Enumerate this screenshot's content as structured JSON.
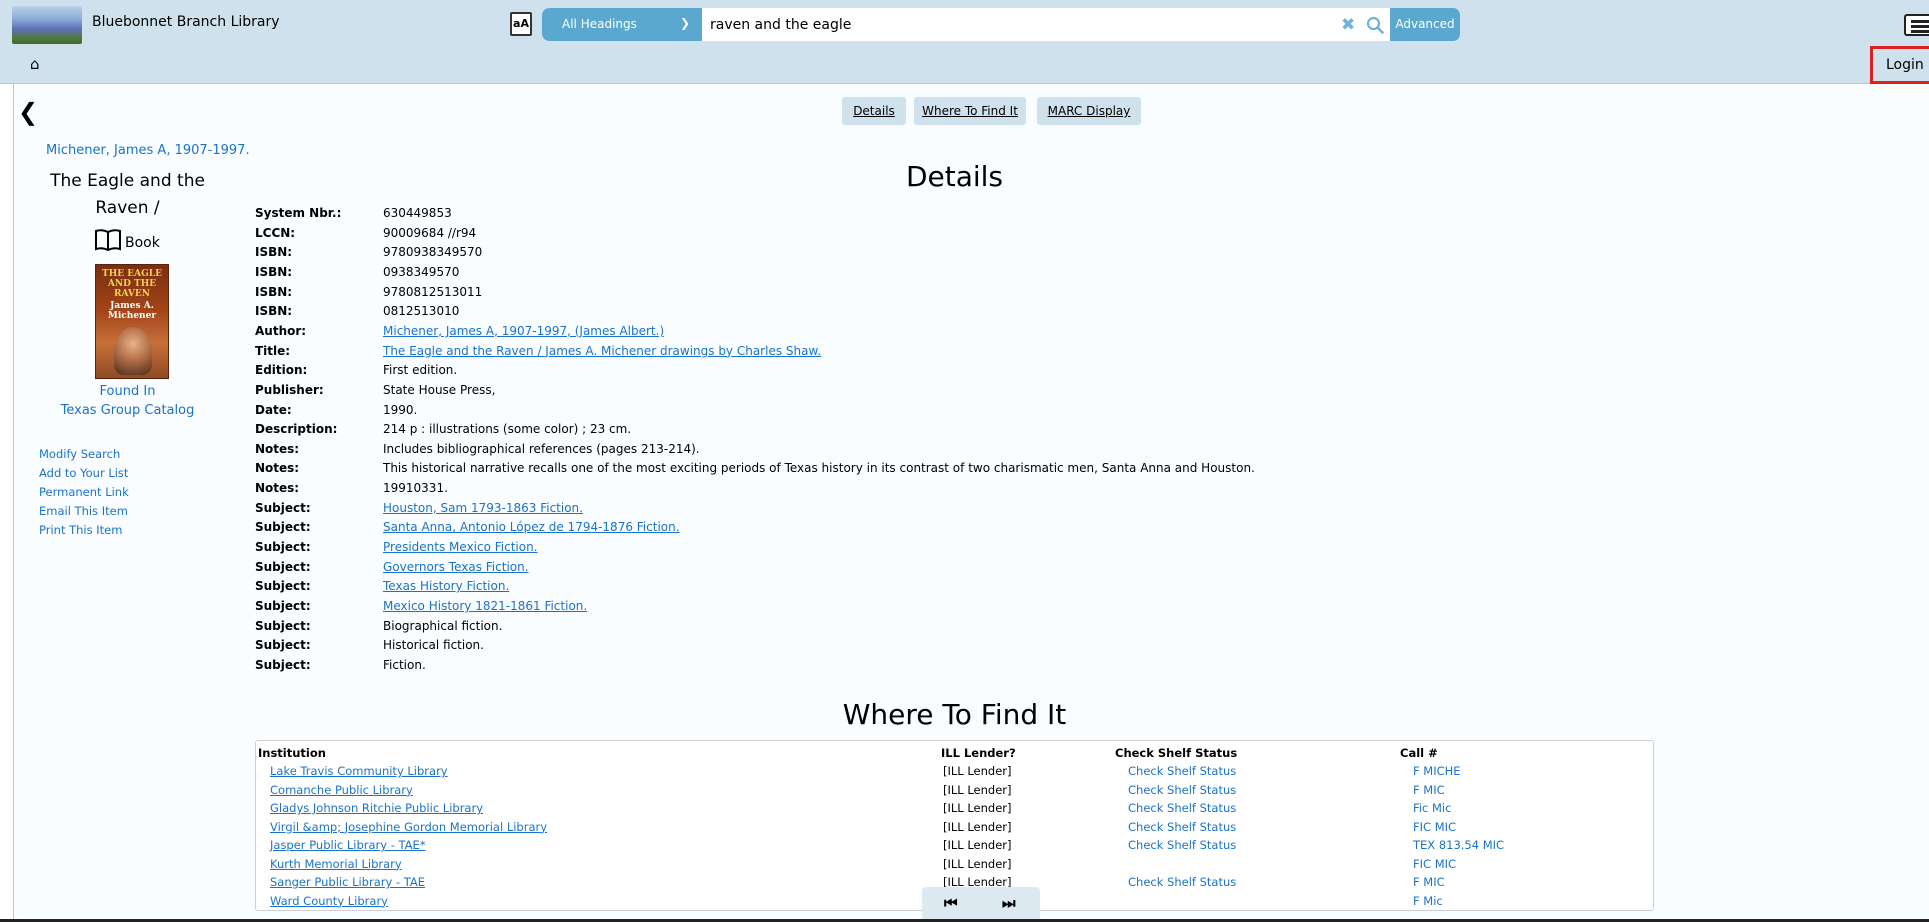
{
  "header": {
    "library_name": "Bluebonnet Branch Library",
    "search_scope": "All Headings",
    "search_query": "raven and the eagle",
    "advanced_label": "Advanced",
    "login_label": "Login",
    "translate_glyph": "aA"
  },
  "tabs": [
    "Details",
    "Where To Find It",
    "MARC Display"
  ],
  "sidebar": {
    "author": "Michener, James A, 1907-1997.",
    "title_line1": "The Eagle and the",
    "title_line2": "Raven /",
    "format": "Book",
    "cover_title": "THE EAGLE AND THE RAVEN",
    "cover_author": "James A. Michener",
    "found_in_line1": "Found In",
    "found_in_line2": "Texas Group Catalog",
    "actions": [
      "Modify Search",
      "Add to Your List",
      "Permanent Link",
      "Email This Item",
      "Print This Item"
    ]
  },
  "details": {
    "heading": "Details",
    "rows": [
      {
        "label": "System Nbr.:",
        "value": "630449853",
        "link": false
      },
      {
        "label": "LCCN:",
        "value": "90009684 //r94",
        "link": false
      },
      {
        "label": "ISBN:",
        "value": "9780938349570",
        "link": false
      },
      {
        "label": "ISBN:",
        "value": "0938349570",
        "link": false
      },
      {
        "label": "ISBN:",
        "value": "9780812513011",
        "link": false
      },
      {
        "label": "ISBN:",
        "value": "0812513010",
        "link": false
      },
      {
        "label": "Author:",
        "value": "Michener, James A, 1907-1997, (James Albert.)",
        "link": true
      },
      {
        "label": "Title:",
        "value": "The Eagle and the Raven / James A. Michener drawings by Charles Shaw.",
        "link": true
      },
      {
        "label": "Edition:",
        "value": "First edition.",
        "link": false
      },
      {
        "label": "Publisher:",
        "value": "State House Press,",
        "link": false
      },
      {
        "label": "Date:",
        "value": "1990.",
        "link": false
      },
      {
        "label": "Description:",
        "value": "214 p : illustrations (some color) ; 23 cm.",
        "link": false
      },
      {
        "label": "Notes:",
        "value": "Includes bibliographical references (pages 213-214).",
        "link": false
      },
      {
        "label": "Notes:",
        "value": "This historical narrative recalls one of the most exciting periods of Texas history in its contrast of two charismatic men, Santa Anna and Houston.",
        "link": false
      },
      {
        "label": "Notes:",
        "value": "19910331.",
        "link": false
      },
      {
        "label": "Subject:",
        "value": "Houston, Sam 1793-1863 Fiction.",
        "link": true
      },
      {
        "label": "Subject:",
        "value": "Santa Anna, Antonio López de 1794-1876 Fiction.",
        "link": true
      },
      {
        "label": "Subject:",
        "value": "Presidents Mexico Fiction.",
        "link": true
      },
      {
        "label": "Subject:",
        "value": "Governors Texas Fiction.",
        "link": true
      },
      {
        "label": "Subject:",
        "value": "Texas History Fiction.",
        "link": true
      },
      {
        "label": "Subject:",
        "value": "Mexico History 1821-1861 Fiction.",
        "link": true
      },
      {
        "label": "Subject:",
        "value": "Biographical fiction.",
        "link": false
      },
      {
        "label": "Subject:",
        "value": "Historical fiction.",
        "link": false
      },
      {
        "label": "Subject:",
        "value": "Fiction.",
        "link": false
      }
    ]
  },
  "where_to_find": {
    "heading": "Where To Find It",
    "columns": [
      "Institution",
      "ILL Lender?",
      "Check Shelf Status",
      "Call #"
    ],
    "rows": [
      {
        "institution": "Lake Travis Community Library",
        "ill": "[ILL Lender]",
        "status": "Check Shelf Status",
        "call": "F MICHE"
      },
      {
        "institution": "Comanche Public Library",
        "ill": "[ILL Lender]",
        "status": "Check Shelf Status",
        "call": "F MIC"
      },
      {
        "institution": "Gladys Johnson Ritchie Public Library",
        "ill": "[ILL Lender]",
        "status": "Check Shelf Status",
        "call": "Fic Mic"
      },
      {
        "institution": "Virgil &amp; Josephine Gordon Memorial Library",
        "ill": "[ILL Lender]",
        "status": "Check Shelf Status",
        "call": "FIC MIC"
      },
      {
        "institution": "Jasper Public Library - TAE*",
        "ill": "[ILL Lender]",
        "status": "Check Shelf Status",
        "call": "TEX 813.54 MIC"
      },
      {
        "institution": "Kurth Memorial Library",
        "ill": "[ILL Lender]",
        "status": "",
        "call": "FIC MIC"
      },
      {
        "institution": "Sanger Public Library - TAE",
        "ill": "[ILL Lender]",
        "status": "Check Shelf Status",
        "call": "F MIC"
      },
      {
        "institution": "Ward County Library",
        "ill": "",
        "status": "",
        "call": "F Mic"
      }
    ]
  },
  "pager": {
    "first": "⏮",
    "last": "⏭"
  },
  "colors": {
    "header_bg": "#cfe1ec",
    "accent": "#5aa7cf",
    "link": "#1a73c9",
    "login_outline": "#e02020"
  }
}
